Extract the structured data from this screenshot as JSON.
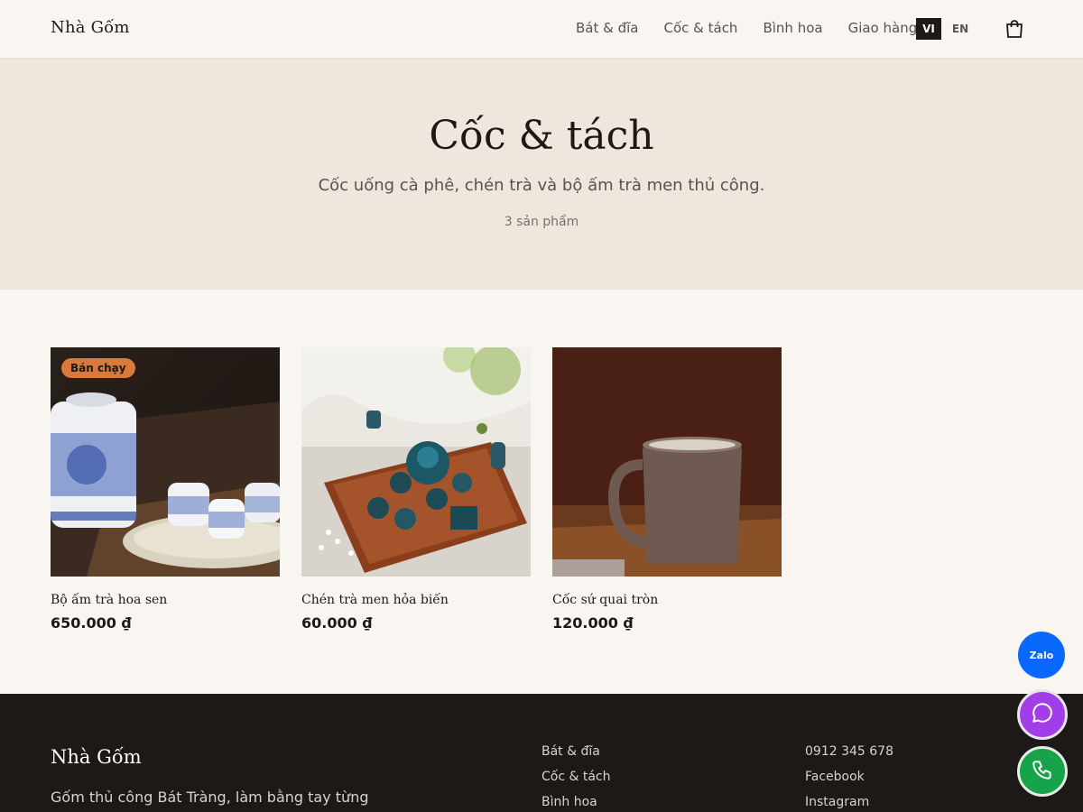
{
  "header": {
    "brand": "Nhà Gốm",
    "nav": [
      "Bát & đĩa",
      "Cốc & tách",
      "Bình hoa",
      "Giao hàng"
    ],
    "lang_vi": "VI",
    "lang_en": "EN",
    "cart_icon": "cart-icon"
  },
  "hero": {
    "title": "Cốc & tách",
    "subtitle": "Cốc uống cà phê, chén trà và bộ ấm trà men thủ công.",
    "count": "3 sản phẩm"
  },
  "products": [
    {
      "badge": "Bán chạy",
      "name": "Bộ ấm trà hoa sen",
      "price": "650.000 ₫"
    },
    {
      "badge": "",
      "name": "Chén trà men hỏa biến",
      "price": "60.000 ₫"
    },
    {
      "badge": "",
      "name": "Cốc sứ quai tròn",
      "price": "120.000 ₫"
    }
  ],
  "footer": {
    "brand": "Nhà Gốm",
    "description": "Gốm thủ công Bát Tràng, làm bằng tay từng",
    "links": [
      "Bát & đĩa",
      "Cốc & tách",
      "Bình hoa"
    ],
    "contact": [
      "0912 345 678",
      "Facebook",
      "Instagram"
    ]
  },
  "floating": {
    "zalo": "Zalo",
    "message_icon": "chat-bubble-icon",
    "call_icon": "phone-icon"
  },
  "colors": {
    "accent": "#d97a3c",
    "zalo": "#0a68ff",
    "messenger": "#a23ee9",
    "call": "#16a34a",
    "footer_bg": "#1c1917",
    "hero_bg": "#efe7dd"
  }
}
